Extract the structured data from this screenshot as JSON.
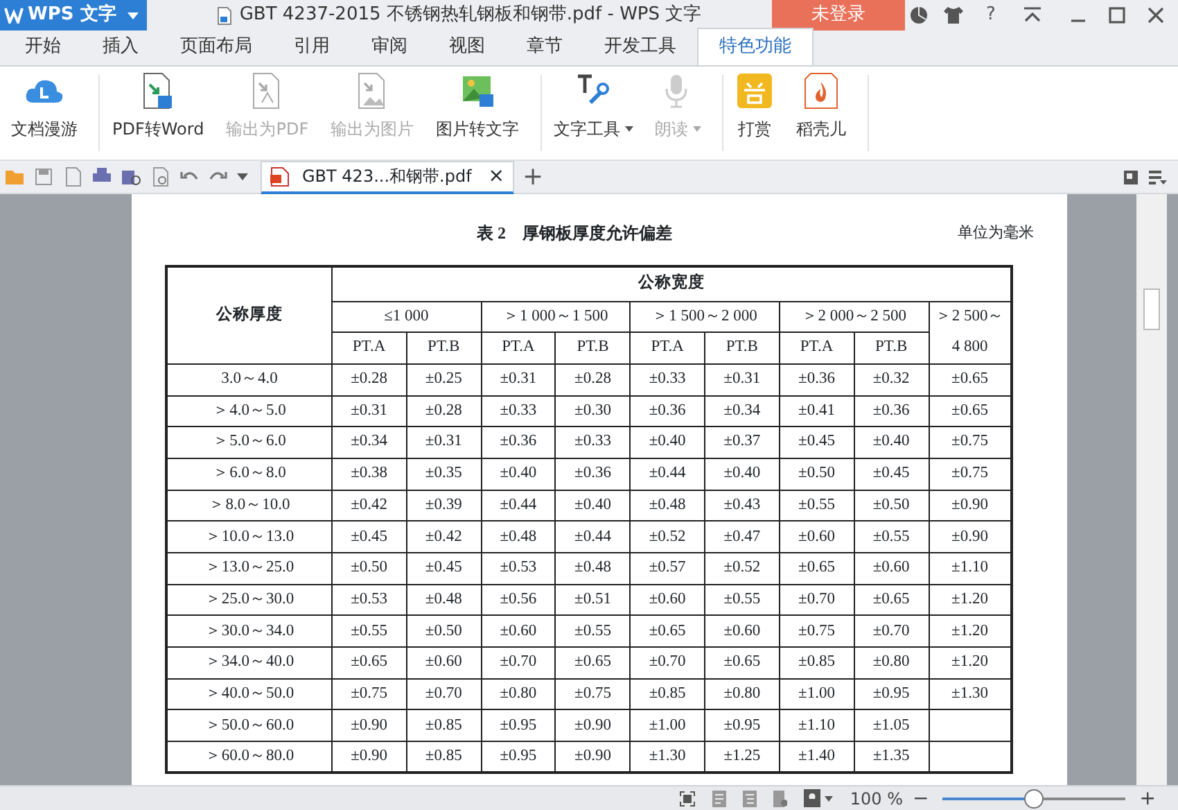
{
  "app": {
    "logo": "WPS 文字",
    "doc_title": "GBT 4237-2015 不锈钢热轧钢板和钢带.pdf - WPS 文字",
    "login": "未登录",
    "help": "?"
  },
  "menu_tabs": [
    {
      "label": "开始",
      "selected": false
    },
    {
      "label": "插入",
      "selected": false
    },
    {
      "label": "页面布局",
      "selected": false
    },
    {
      "label": "引用",
      "selected": false
    },
    {
      "label": "审阅",
      "selected": false
    },
    {
      "label": "视图",
      "selected": false
    },
    {
      "label": "章节",
      "selected": false
    },
    {
      "label": "开发工具",
      "selected": false
    },
    {
      "label": "特色功能",
      "selected": true
    }
  ],
  "ribbon_groups": [
    {
      "items": [
        {
          "label": "文档漫游",
          "disabled": false,
          "dropdown": false
        }
      ]
    },
    {
      "items": [
        {
          "label": "PDF转Word",
          "disabled": false,
          "dropdown": false
        },
        {
          "label": "输出为PDF",
          "disabled": true,
          "dropdown": false
        },
        {
          "label": "输出为图片",
          "disabled": true,
          "dropdown": false
        },
        {
          "label": "图片转文字",
          "disabled": false,
          "dropdown": false
        }
      ]
    },
    {
      "items": [
        {
          "label": "文字工具",
          "disabled": false,
          "dropdown": true
        },
        {
          "label": "朗读",
          "disabled": true,
          "dropdown": true
        }
      ]
    },
    {
      "items": [
        {
          "label": "打赏",
          "disabled": false,
          "dropdown": false
        },
        {
          "label": "稻壳儿",
          "disabled": false,
          "dropdown": false
        }
      ]
    }
  ],
  "doc_tab": {
    "label": "GBT 423...和钢带.pdf",
    "close": "×",
    "new_tab": "+"
  },
  "document": {
    "caption": "表 2　厚钢板厚度允许偏差",
    "unit": "单位为毫米",
    "table": {
      "row_header": "公称厚度",
      "group_header": "公称宽度",
      "width_ranges": [
        "≤1 000",
        "＞1 000～1 500",
        "＞1 500～2 000",
        "＞2 000～2 500",
        "＞2 500～4 800"
      ],
      "sub_columns": [
        "PT.A",
        "PT.B",
        "PT.A",
        "PT.B",
        "PT.A",
        "PT.B",
        "PT.A",
        "PT.B"
      ],
      "rows": [
        {
          "thickness": "3.0～4.0",
          "values": [
            "±0.28",
            "±0.25",
            "±0.31",
            "±0.28",
            "±0.33",
            "±0.31",
            "±0.36",
            "±0.32",
            "±0.65"
          ]
        },
        {
          "thickness": "＞4.0～5.0",
          "values": [
            "±0.31",
            "±0.28",
            "±0.33",
            "±0.30",
            "±0.36",
            "±0.34",
            "±0.41",
            "±0.36",
            "±0.65"
          ]
        },
        {
          "thickness": "＞5.0～6.0",
          "values": [
            "±0.34",
            "±0.31",
            "±0.36",
            "±0.33",
            "±0.40",
            "±0.37",
            "±0.45",
            "±0.40",
            "±0.75"
          ]
        },
        {
          "thickness": "＞6.0～8.0",
          "values": [
            "±0.38",
            "±0.35",
            "±0.40",
            "±0.36",
            "±0.44",
            "±0.40",
            "±0.50",
            "±0.45",
            "±0.75"
          ]
        },
        {
          "thickness": "＞8.0～10.0",
          "values": [
            "±0.42",
            "±0.39",
            "±0.44",
            "±0.40",
            "±0.48",
            "±0.43",
            "±0.55",
            "±0.50",
            "±0.90"
          ]
        },
        {
          "thickness": "＞10.0～13.0",
          "values": [
            "±0.45",
            "±0.42",
            "±0.48",
            "±0.44",
            "±0.52",
            "±0.47",
            "±0.60",
            "±0.55",
            "±0.90"
          ]
        },
        {
          "thickness": "＞13.0～25.0",
          "values": [
            "±0.50",
            "±0.45",
            "±0.53",
            "±0.48",
            "±0.57",
            "±0.52",
            "±0.65",
            "±0.60",
            "±1.10"
          ]
        },
        {
          "thickness": "＞25.0～30.0",
          "values": [
            "±0.53",
            "±0.48",
            "±0.56",
            "±0.51",
            "±0.60",
            "±0.55",
            "±0.70",
            "±0.65",
            "±1.20"
          ]
        },
        {
          "thickness": "＞30.0～34.0",
          "values": [
            "±0.55",
            "±0.50",
            "±0.60",
            "±0.55",
            "±0.65",
            "±0.60",
            "±0.75",
            "±0.70",
            "±1.20"
          ]
        },
        {
          "thickness": "＞34.0～40.0",
          "values": [
            "±0.65",
            "±0.60",
            "±0.70",
            "±0.65",
            "±0.70",
            "±0.65",
            "±0.85",
            "±0.80",
            "±1.20"
          ]
        },
        {
          "thickness": "＞40.0～50.0",
          "values": [
            "±0.75",
            "±0.70",
            "±0.80",
            "±0.75",
            "±0.85",
            "±0.80",
            "±1.00",
            "±0.95",
            "±1.30"
          ]
        },
        {
          "thickness": "＞50.0～60.0",
          "values": [
            "±0.90",
            "±0.85",
            "±0.95",
            "±0.90",
            "±1.00",
            "±0.95",
            "±1.10",
            "±1.05"
          ]
        },
        {
          "thickness": "＞60.0～80.0",
          "values": [
            "±0.90",
            "±0.85",
            "±0.95",
            "±0.90",
            "±1.30",
            "±1.25",
            "±1.40",
            "±1.35"
          ]
        }
      ]
    }
  },
  "status_bar": {
    "zoom": "100 %",
    "minus": "−",
    "plus": "+",
    "zoom_slider": {
      "level": 0.5
    }
  }
}
